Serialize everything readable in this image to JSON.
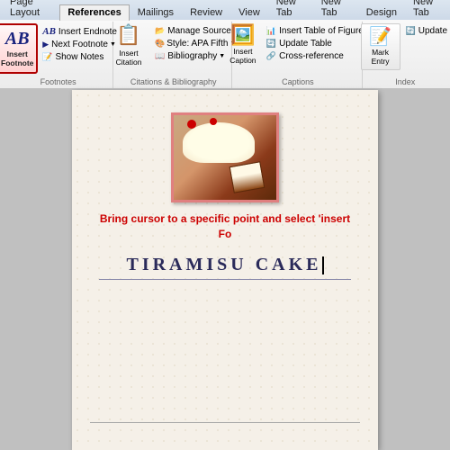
{
  "ribbon": {
    "tabs": [
      {
        "label": "Page Layout",
        "active": false
      },
      {
        "label": "References",
        "active": true
      },
      {
        "label": "Mailings",
        "active": false
      },
      {
        "label": "Review",
        "active": false
      },
      {
        "label": "View",
        "active": false
      },
      {
        "label": "New Tab",
        "active": false
      },
      {
        "label": "New Tab",
        "active": false
      },
      {
        "label": "Design",
        "active": false
      },
      {
        "label": "New Tab",
        "active": false
      }
    ],
    "groups": {
      "footnotes": {
        "label": "Footnotes",
        "insert_footnote": "Insert\nFootnote",
        "insert_endnote": "Insert Endnote",
        "next_footnote": "Next Footnote",
        "show_notes": "Show Notes"
      },
      "citations": {
        "label": "Citations & Bibliography",
        "manage_sources": "Manage Sources",
        "style": "Style: APA Fifth",
        "insert_citation": "Insert\nCitation",
        "bibliography": "Bibliography"
      },
      "captions": {
        "label": "Captions",
        "insert_caption": "Insert\nCaption",
        "insert_table_of_figures": "Insert Table of Figures",
        "update_table": "Update Table",
        "cross_reference": "Cross-reference"
      },
      "index": {
        "label": "Index",
        "mark_entry": "Mark\nEntry",
        "update": "Update"
      }
    }
  },
  "document": {
    "instruction": "Bring cursor to a specific point and select 'insert Fo",
    "title": "TIRAMISU CAKE"
  }
}
